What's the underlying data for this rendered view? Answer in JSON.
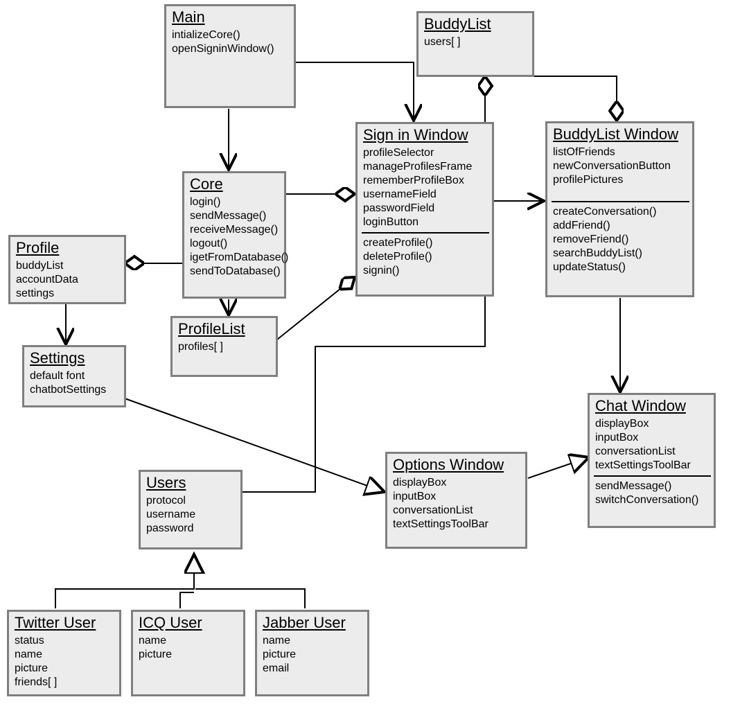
{
  "classes": {
    "main": {
      "title": "Main",
      "attrs": [
        "intializeCore()",
        "openSigninWindow()"
      ]
    },
    "buddyList": {
      "title": "BuddyList",
      "attrs": [
        "users[ ]"
      ]
    },
    "core": {
      "title": "Core",
      "attrs": [
        "login()",
        "sendMessage()",
        "receiveMessage()",
        "logout()",
        "igetFromDatabase()",
        "sendToDatabase()"
      ]
    },
    "signin": {
      "title": "Sign in Window",
      "attrs": [
        "profileSelector",
        "manageProfilesFrame",
        "rememberProfileBox",
        "usernameField",
        "passwordField",
        "loginButton"
      ],
      "ops": [
        "createProfile()",
        "deleteProfile()",
        "signin()"
      ]
    },
    "buddyListWindow": {
      "title": "BuddyList Window",
      "attrs": [
        "listOfFriends",
        "newConversationButton",
        "profilePictures"
      ],
      "ops": [
        "createConversation()",
        "addFriend()",
        "removeFriend()",
        "searchBuddyList()",
        "updateStatus()"
      ]
    },
    "profile": {
      "title": "Profile",
      "attrs": [
        "buddyList",
        "accountData",
        "settings"
      ]
    },
    "profileList": {
      "title": "ProfileList",
      "attrs": [
        "profiles[ ]"
      ]
    },
    "settings": {
      "title": "Settings",
      "attrs": [
        "default font",
        "chatbotSettings"
      ]
    },
    "chatWindow": {
      "title": "Chat Window",
      "attrs": [
        "displayBox",
        "inputBox",
        "conversationList",
        "textSettingsToolBar"
      ],
      "ops": [
        "sendMessage()",
        "switchConversation()"
      ]
    },
    "optionsWindow": {
      "title": "Options Window",
      "attrs": [
        "displayBox",
        "inputBox",
        "conversationList",
        "textSettingsToolBar"
      ]
    },
    "users": {
      "title": "Users",
      "attrs": [
        "protocol",
        "username",
        "password"
      ]
    },
    "twitterUser": {
      "title": "Twitter User",
      "attrs": [
        "status",
        "name",
        "picture",
        "friends[ ]"
      ]
    },
    "icqUser": {
      "title": "ICQ User",
      "attrs": [
        "name",
        "picture"
      ]
    },
    "jabberUser": {
      "title": "Jabber User",
      "attrs": [
        "name",
        "picture",
        "email"
      ]
    }
  }
}
